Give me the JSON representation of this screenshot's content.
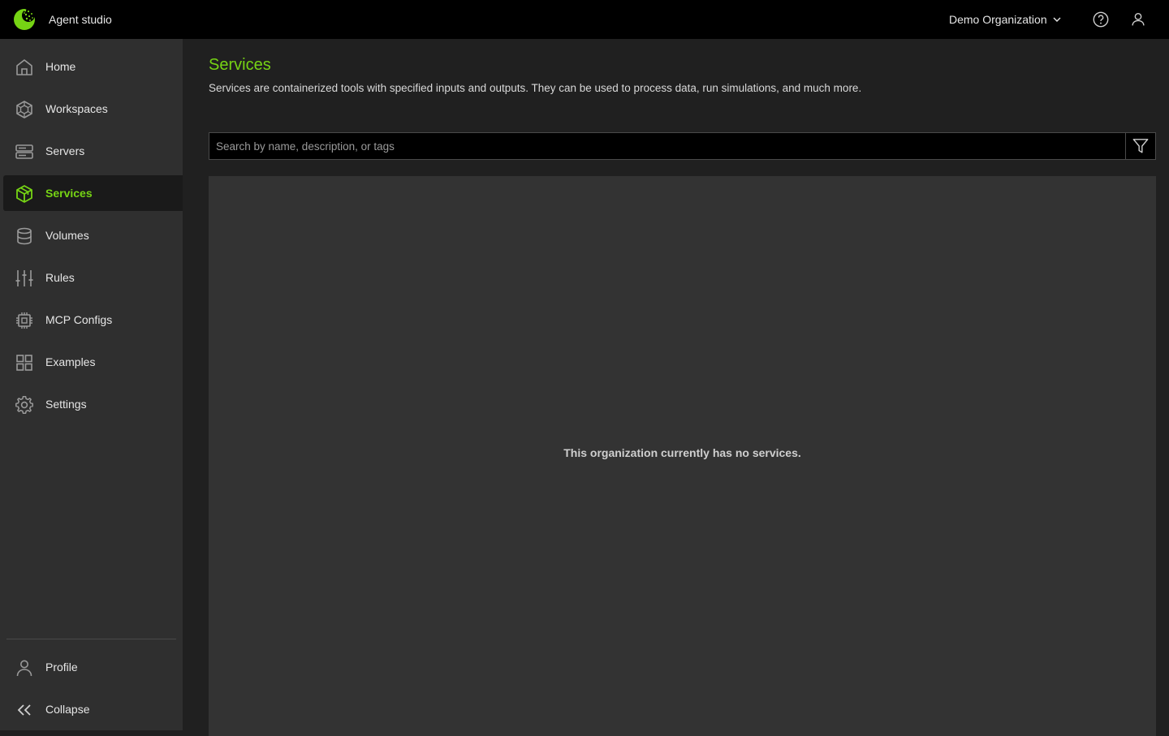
{
  "header": {
    "app_title": "Agent studio",
    "org_name": "Demo Organization",
    "icons": [
      "help-circle-icon",
      "user-icon",
      "chevron-down-icon"
    ]
  },
  "sidebar": {
    "items": [
      {
        "label": "Home",
        "icon": "home-icon"
      },
      {
        "label": "Workspaces",
        "icon": "workspaces-icon"
      },
      {
        "label": "Servers",
        "icon": "servers-icon"
      },
      {
        "label": "Services",
        "icon": "services-icon",
        "active": true
      },
      {
        "label": "Volumes",
        "icon": "volumes-icon"
      },
      {
        "label": "Rules",
        "icon": "rules-icon"
      },
      {
        "label": "MCP Configs",
        "icon": "chip-icon"
      },
      {
        "label": "Examples",
        "icon": "grid-icon"
      },
      {
        "label": "Settings",
        "icon": "gear-icon"
      }
    ],
    "bottom": [
      {
        "label": "Profile",
        "icon": "user-icon"
      },
      {
        "label": "Collapse",
        "icon": "double-chevron-left-icon"
      }
    ]
  },
  "main": {
    "title": "Services",
    "description": "Services are containerized tools with specified inputs and outputs. They can be used to process data, run simulations, and much more.",
    "search": {
      "placeholder": "Search by name, description, or tags",
      "value": ""
    },
    "empty_message": "This organization currently has no services."
  },
  "colors": {
    "accent": "#76d414",
    "topbar_bg": "#000000",
    "sidebar_bg": "#2f2f2f",
    "main_bg": "#202020",
    "panel_bg": "#333333"
  }
}
